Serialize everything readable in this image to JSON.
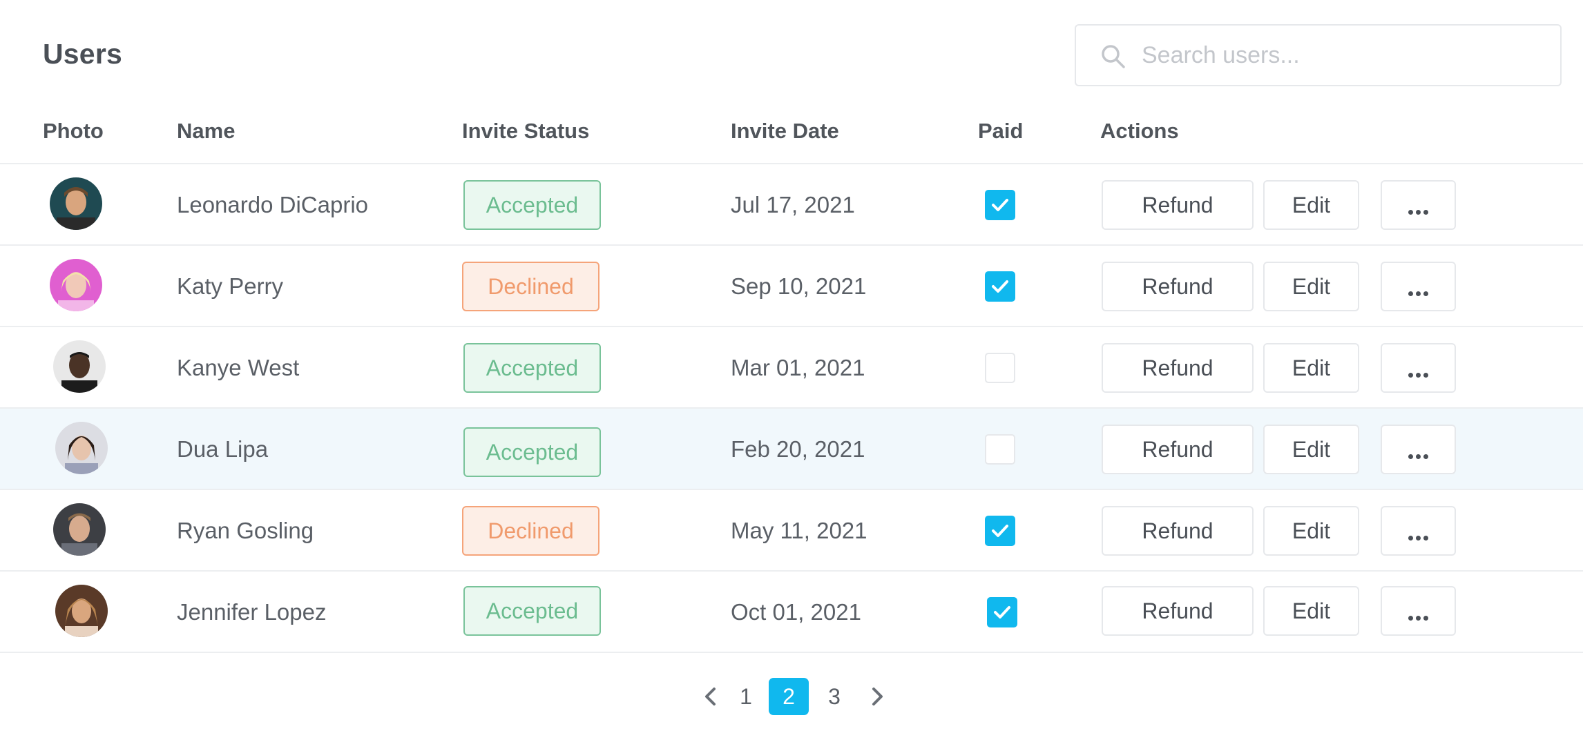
{
  "header": {
    "title": "Users",
    "search_placeholder": "Search users...",
    "search_value": ""
  },
  "columns": [
    "Photo",
    "Name",
    "Invite Status",
    "Invite Date",
    "Paid",
    "Actions"
  ],
  "rows": [
    {
      "name": "Leonardo DiCaprio",
      "status": "Accepted",
      "date": "Jul 17, 2021",
      "paid": true
    },
    {
      "name": "Katy Perry",
      "status": "Declined",
      "date": "Sep 10, 2021",
      "paid": true
    },
    {
      "name": "Kanye West",
      "status": "Accepted",
      "date": "Mar 01, 2021",
      "paid": false
    },
    {
      "name": "Dua Lipa",
      "status": "Accepted",
      "date": "Feb 20, 2021",
      "paid": false
    },
    {
      "name": "Ryan Gosling",
      "status": "Declined",
      "date": "May 11, 2021",
      "paid": true
    },
    {
      "name": "Jennifer Lopez",
      "status": "Accepted",
      "date": "Oct 01, 2021",
      "paid": true
    }
  ],
  "actions": {
    "refund": "Refund",
    "edit": "Edit",
    "more_icon": "more-horizontal-icon"
  },
  "pagination": {
    "pages": [
      "1",
      "2",
      "3"
    ],
    "current": "2",
    "prev_icon": "chevron-left-icon",
    "next_icon": "chevron-right-icon"
  },
  "colors": {
    "accent": "#10b8ee",
    "accepted": "#6bbc8f",
    "declined": "#f09a6c",
    "highlight_row": "#f1f8fc"
  }
}
